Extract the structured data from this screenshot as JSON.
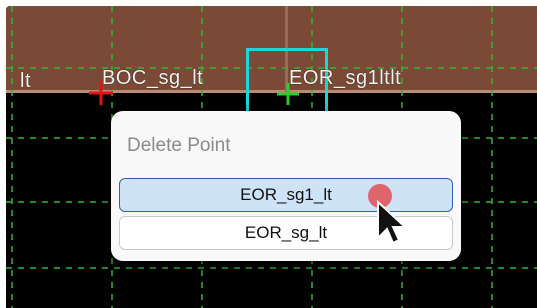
{
  "canvas": {
    "labels": {
      "left_fragment": "lt",
      "boc": "BOC_sg_lt",
      "eor": "EOR_sg1ltlt"
    },
    "colors": {
      "background": "#000000",
      "band": "#7a4a36",
      "grid": "#35b435",
      "cyan": "#16d6e0",
      "red_marker": "#e11414",
      "green_marker": "#2ecc2e"
    }
  },
  "context_menu": {
    "title": "Delete Point",
    "items": [
      {
        "label": "EOR_sg1_lt",
        "highlighted": true
      },
      {
        "label": "EOR_sg_lt",
        "highlighted": false
      }
    ]
  },
  "cursor": {
    "icon": "arrow-pointer-icon",
    "click_indicator": "click-dot-icon"
  }
}
